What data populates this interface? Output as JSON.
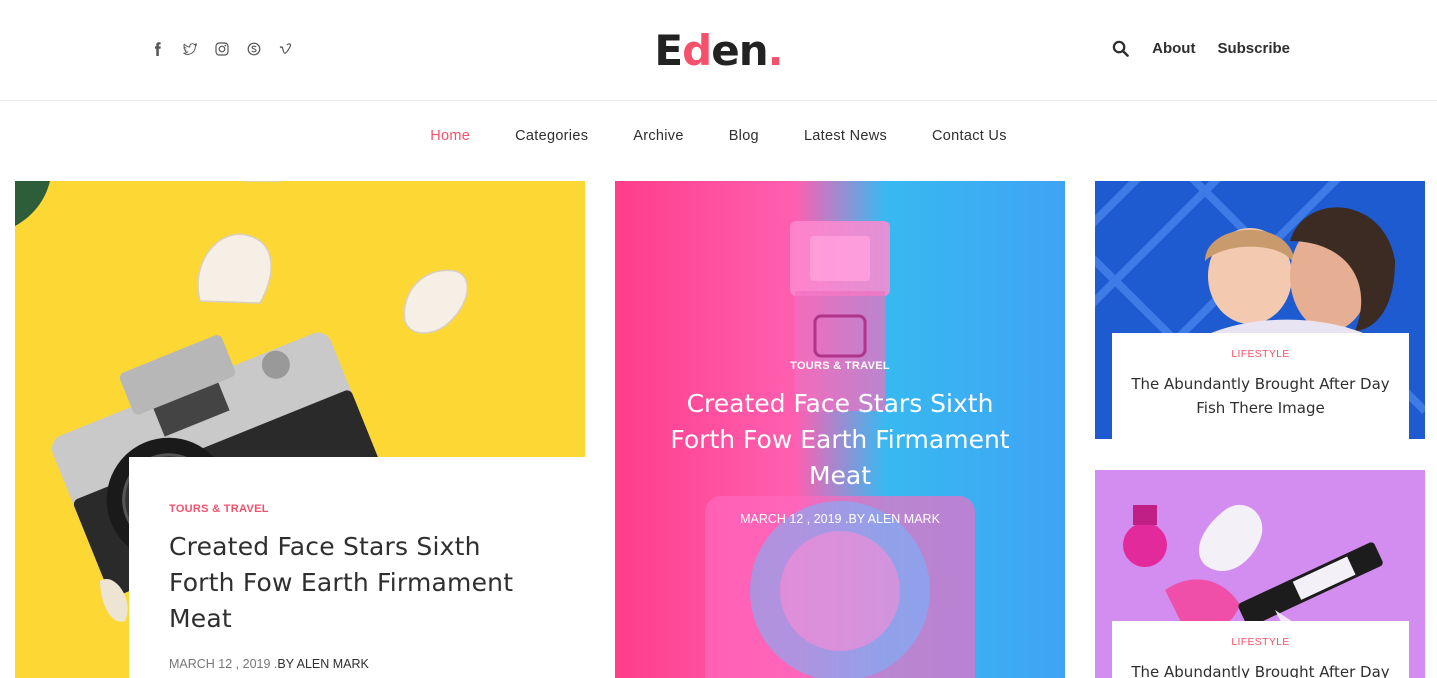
{
  "header": {
    "socials": [
      "facebook-icon",
      "twitter-icon",
      "instagram-icon",
      "skype-icon",
      "vimeo-icon"
    ],
    "logo": {
      "main": "Ed",
      "accent_letter": "e",
      "rest": "n",
      "dot": "."
    },
    "about_label": "About",
    "subscribe_label": "Subscribe"
  },
  "nav": {
    "items": [
      "Home",
      "Categories",
      "Archive",
      "Blog",
      "Latest News",
      "Contact Us"
    ],
    "active": "Home"
  },
  "cards": {
    "featured": {
      "category": "TOURS & TRAVEL",
      "title": "Created Face Stars Sixth Forth Fow Earth Firmament Meat",
      "date": "MARCH 12 , 2019 .",
      "author": "BY ALEN MARK"
    },
    "center": {
      "category": "TOURS & TRAVEL",
      "title": "Created Face Stars Sixth Forth Fow Earth Firmament Meat",
      "meta": "MARCH 12 , 2019 .BY ALEN MARK"
    },
    "side_top": {
      "category": "LIFESTYLE",
      "title": "The Abundantly Brought After Day Fish There Image"
    },
    "side_bottom": {
      "category": "LIFESTYLE",
      "title": "The Abundantly Brought After Day"
    }
  },
  "colors": {
    "accent": "#f4516c",
    "text": "#2f2f2f",
    "yellow_bg": "#fdd835",
    "blue_bg": "#1e5bd0",
    "lilac_bg": "#d38cf0"
  }
}
